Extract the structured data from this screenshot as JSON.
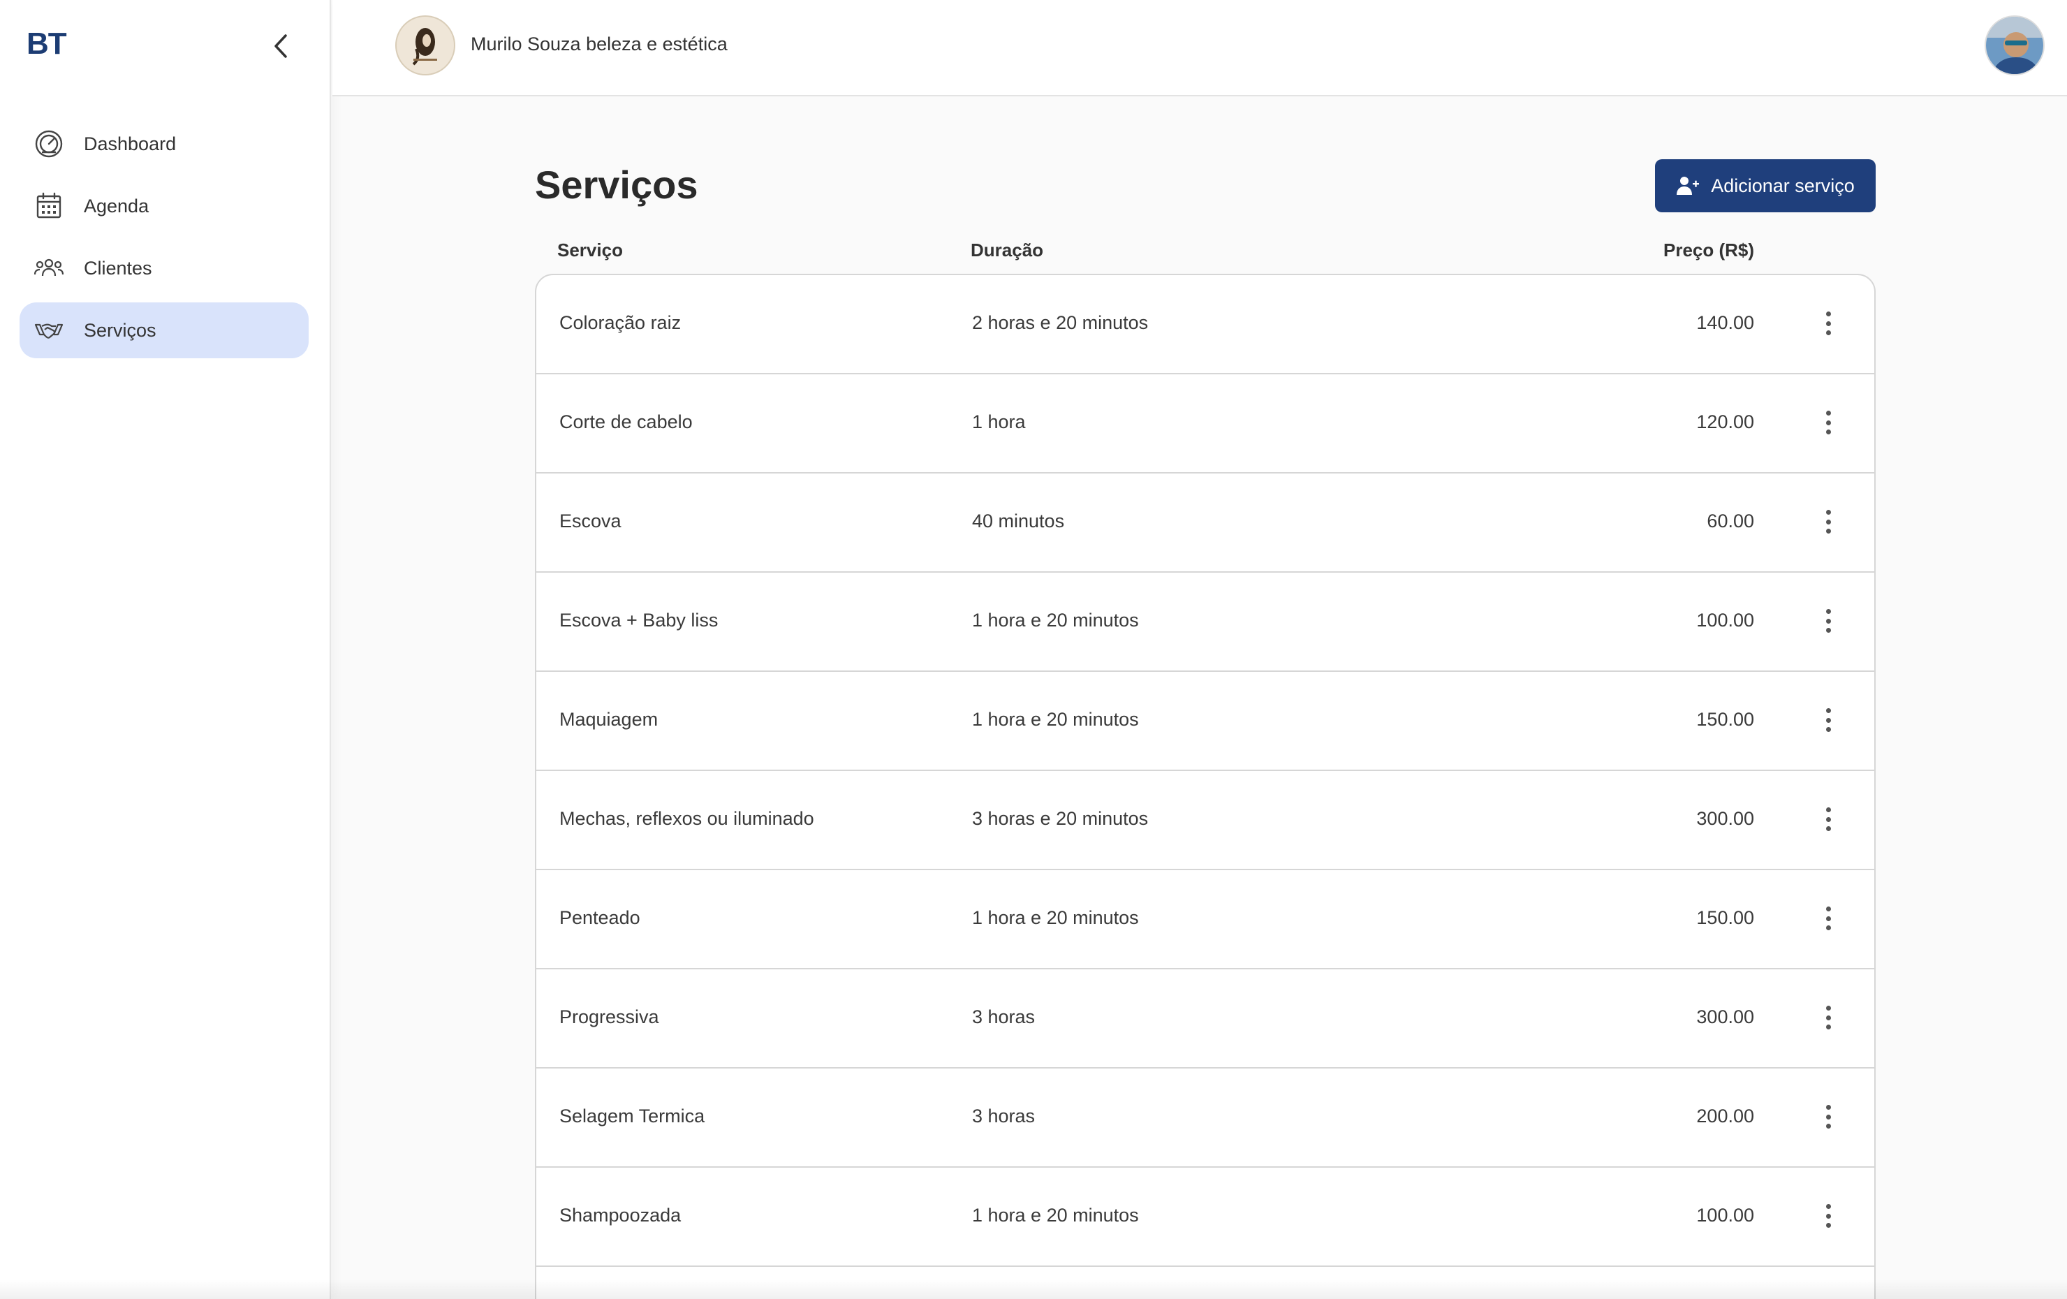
{
  "sidebar": {
    "logo": "BT",
    "items": [
      {
        "label": "Dashboard",
        "icon": "dashboard-gauge-icon"
      },
      {
        "label": "Agenda",
        "icon": "calendar-icon"
      },
      {
        "label": "Clientes",
        "icon": "users-icon"
      },
      {
        "label": "Serviços",
        "icon": "handshake-icon",
        "active": true
      }
    ]
  },
  "header": {
    "business_name": "Murilo Souza beleza e estética",
    "brand_logo_icon": "hair-salon-logo-icon",
    "user_avatar_icon": "user-avatar-icon"
  },
  "main": {
    "title": "Serviços",
    "add_button_label": "Adicionar serviço",
    "columns": {
      "service": "Serviço",
      "duration": "Duração",
      "price": "Preço (R$)"
    },
    "rows": [
      {
        "service": "Coloração raiz",
        "duration": "2 horas e 20 minutos",
        "price": "140.00"
      },
      {
        "service": "Corte de cabelo",
        "duration": "1 hora",
        "price": "120.00"
      },
      {
        "service": "Escova",
        "duration": "40 minutos",
        "price": "60.00"
      },
      {
        "service": "Escova + Baby liss",
        "duration": "1 hora e 20 minutos",
        "price": "100.00"
      },
      {
        "service": "Maquiagem",
        "duration": "1 hora e 20 minutos",
        "price": "150.00"
      },
      {
        "service": "Mechas, reflexos ou iluminado",
        "duration": "3 horas e 20 minutos",
        "price": "300.00"
      },
      {
        "service": "Penteado",
        "duration": "1 hora e 20 minutos",
        "price": "150.00"
      },
      {
        "service": "Progressiva",
        "duration": "3 horas",
        "price": "300.00"
      },
      {
        "service": "Selagem Termica",
        "duration": "3 horas",
        "price": "200.00"
      },
      {
        "service": "Shampoozada",
        "duration": "1 hora e 20 minutos",
        "price": "100.00"
      }
    ]
  },
  "colors": {
    "accent": "#1f3f7c",
    "active_nav": "#d9e3fb",
    "logo": "#1c3c73"
  }
}
